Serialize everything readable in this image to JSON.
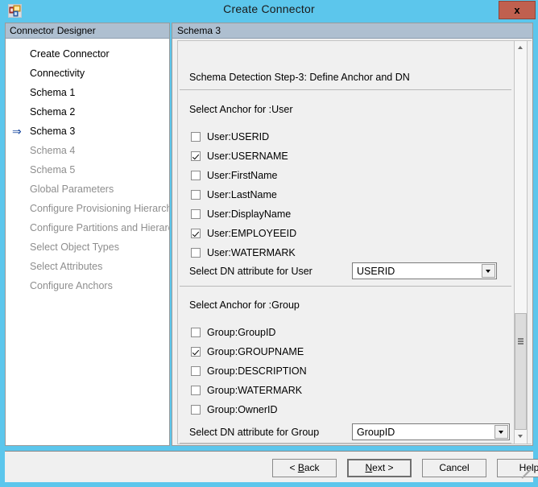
{
  "window": {
    "title": "Create Connector",
    "icon": "connector-icon",
    "close_label": "x",
    "accent_color": "#5cc6ec",
    "close_color": "#c0604f"
  },
  "left_pane": {
    "header": "Connector Designer",
    "items": [
      {
        "label": "Create Connector",
        "enabled": true,
        "current": false
      },
      {
        "label": "Connectivity",
        "enabled": true,
        "current": false
      },
      {
        "label": "Schema 1",
        "enabled": true,
        "current": false
      },
      {
        "label": "Schema 2",
        "enabled": true,
        "current": false
      },
      {
        "label": "Schema 3",
        "enabled": true,
        "current": true
      },
      {
        "label": "Schema 4",
        "enabled": false,
        "current": false
      },
      {
        "label": "Schema 5",
        "enabled": false,
        "current": false
      },
      {
        "label": "Global Parameters",
        "enabled": false,
        "current": false
      },
      {
        "label": "Configure Provisioning Hierarchy",
        "enabled": false,
        "current": false
      },
      {
        "label": "Configure Partitions and Hierarchies",
        "enabled": false,
        "current": false
      },
      {
        "label": "Select Object Types",
        "enabled": false,
        "current": false
      },
      {
        "label": "Select Attributes",
        "enabled": false,
        "current": false
      },
      {
        "label": "Configure Anchors",
        "enabled": false,
        "current": false
      }
    ],
    "current_marker": "⇒"
  },
  "right_pane": {
    "header": "Schema 3",
    "step_title": "Schema Detection Step-3: Define Anchor and DN",
    "user_section": {
      "label": "Select Anchor for :User",
      "checkboxes": [
        {
          "label": "User:USERID",
          "checked": false
        },
        {
          "label": "User:USERNAME",
          "checked": true
        },
        {
          "label": "User:FirstName",
          "checked": false
        },
        {
          "label": "User:LastName",
          "checked": false
        },
        {
          "label": "User:DisplayName",
          "checked": false
        },
        {
          "label": "User:EMPLOYEEID",
          "checked": true
        },
        {
          "label": "User:WATERMARK",
          "checked": false
        }
      ],
      "dn_label": "Select DN attribute for User",
      "dn_value": "USERID"
    },
    "group_section": {
      "label": "Select Anchor for :Group",
      "checkboxes": [
        {
          "label": "Group:GroupID",
          "checked": false
        },
        {
          "label": "Group:GROUPNAME",
          "checked": true
        },
        {
          "label": "Group:DESCRIPTION",
          "checked": false
        },
        {
          "label": "Group:WATERMARK",
          "checked": false
        },
        {
          "label": "Group:OwnerID",
          "checked": false
        }
      ],
      "dn_label": "Select DN attribute for Group",
      "dn_value": "GroupID"
    },
    "scrollbar": {
      "up_icon": "chevron-up-icon",
      "down_icon": "chevron-down-icon"
    }
  },
  "buttons": {
    "back": "< Back",
    "back_accel": "B",
    "next": "Next >",
    "next_accel": "N",
    "cancel": "Cancel",
    "help": "Help"
  }
}
